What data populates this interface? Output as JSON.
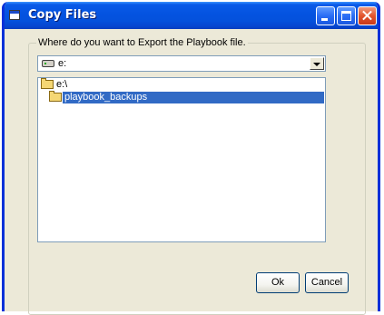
{
  "window": {
    "title": "Copy Files"
  },
  "group": {
    "label": "Where do you want to Export the Playbook file."
  },
  "drive_select": {
    "value": "e:"
  },
  "folders": [
    {
      "label": "e:\\"
    },
    {
      "label": "playbook_backups",
      "selected": true
    }
  ],
  "buttons": {
    "ok_label": "Ok",
    "cancel_label": "Cancel"
  },
  "colors": {
    "titlebar": "#0453e0",
    "selection": "#316ac5",
    "dialog_bg": "#ece9d8"
  }
}
